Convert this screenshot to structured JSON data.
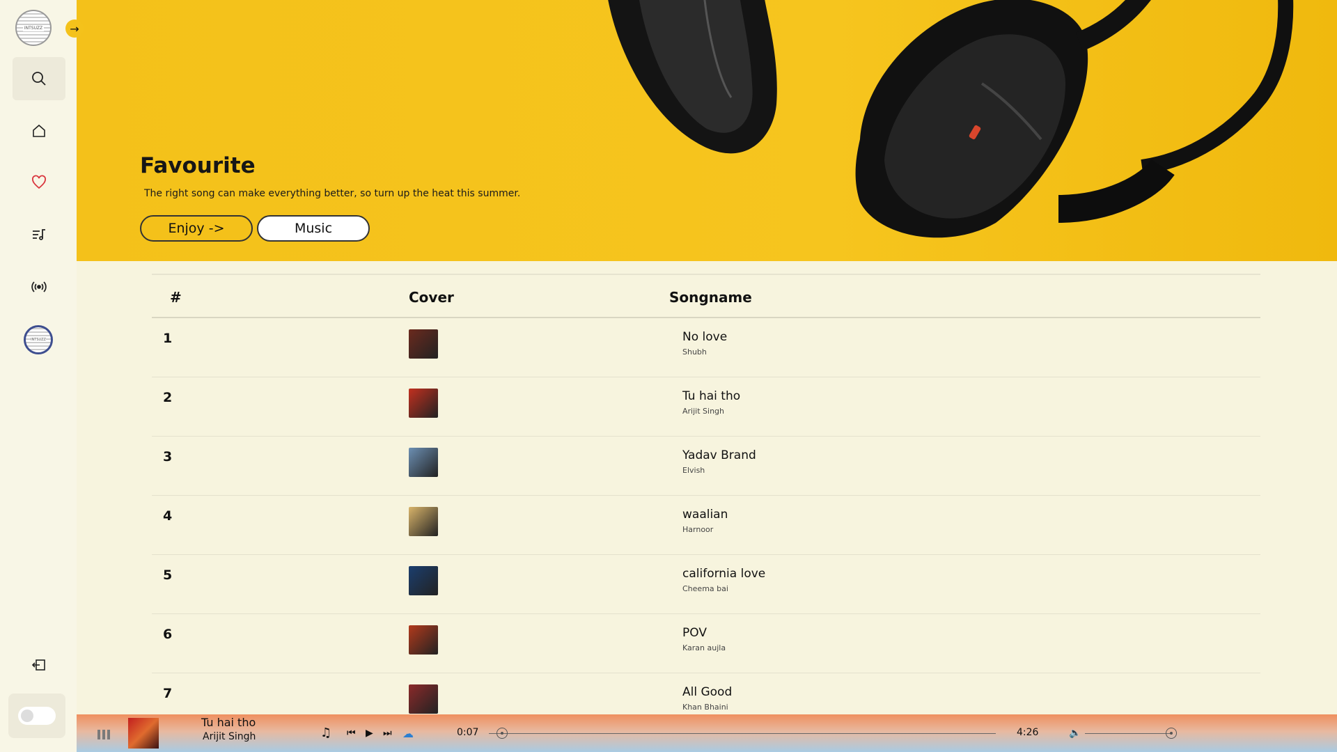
{
  "sidebar": {
    "logo_text": "INTSUZZ",
    "nav": [
      {
        "name": "search-icon",
        "active": true
      },
      {
        "name": "home-icon",
        "active": false
      },
      {
        "name": "heart-icon",
        "active": false
      },
      {
        "name": "playlist-icon",
        "active": false
      },
      {
        "name": "radio-icon",
        "active": false
      }
    ],
    "avatar_text": "INTSUZZ",
    "logout_icon": "logout-icon",
    "theme_toggle": "off"
  },
  "hero": {
    "title": "Favourite",
    "subtitle": "The right song can make everything better, so turn up the heat this summer.",
    "btn_enjoy": "Enjoy ->",
    "btn_music": "Music"
  },
  "table": {
    "headers": {
      "num": "#",
      "cover": "Cover",
      "songname": "Songname"
    },
    "rows": [
      {
        "num": "1",
        "title": "No love",
        "artist": "Shubh",
        "cover_color": "#6b2a1e"
      },
      {
        "num": "2",
        "title": "Tu hai tho",
        "artist": "Arijit Singh",
        "cover_color": "#c2301f"
      },
      {
        "num": "3",
        "title": "Yadav Brand",
        "artist": "Elvish",
        "cover_color": "#6c8fb3"
      },
      {
        "num": "4",
        "title": "waalian",
        "artist": "Harnoor",
        "cover_color": "#d9b46a"
      },
      {
        "num": "5",
        "title": "california love",
        "artist": "Cheema bai",
        "cover_color": "#1b3e6e"
      },
      {
        "num": "6",
        "title": "POV",
        "artist": "Karan aujla",
        "cover_color": "#b23a1c"
      },
      {
        "num": "7",
        "title": "All Good",
        "artist": "Khan Bhaini",
        "cover_color": "#8b2a2a"
      }
    ]
  },
  "player": {
    "title": "Tu hai tho",
    "artist": "Arijit Singh",
    "current_time": "0:07",
    "total_time": "4:26",
    "progress": 0.026,
    "volume": 1.0
  }
}
